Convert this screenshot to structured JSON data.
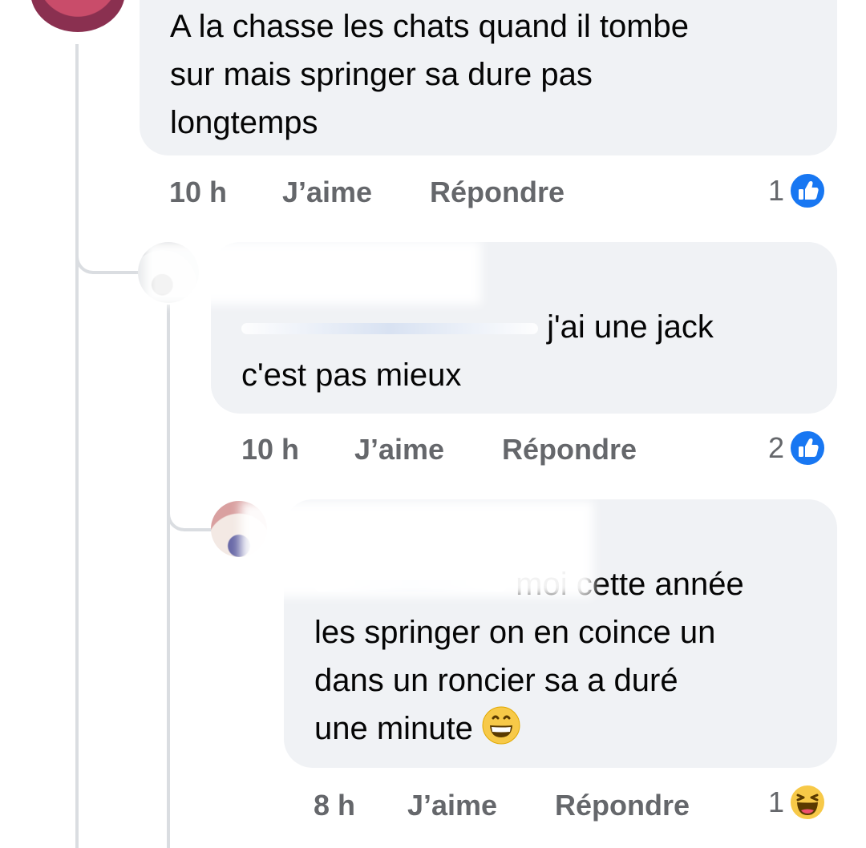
{
  "comments": [
    {
      "text": "A la chasse les chats quand il tombe\nsur mais springer sa dure pas\nlongtemps",
      "time": "10 h",
      "like_label": "J’aime",
      "reply_label": "Répondre",
      "reaction_count": "1",
      "reaction_icon": "like-icon"
    },
    {
      "text_line1": "j'ai une jack",
      "text_line2": "c'est pas mieux",
      "time": "10 h",
      "like_label": "J’aime",
      "reply_label": "Répondre",
      "reaction_count": "2",
      "reaction_icon": "like-icon"
    },
    {
      "text_line1": "moi cette année",
      "text_rest": "les springer on en coince un\ndans un roncier sa a duré\nune minute",
      "emoji": "grinning-face-icon",
      "time": "8 h",
      "like_label": "J’aime",
      "reply_label": "Répondre",
      "reaction_count": "1",
      "reaction_icon": "haha-icon"
    }
  ],
  "colors": {
    "bubble_bg": "#f0f2f5",
    "meta_text": "#65676b",
    "like_blue": "#1877f2",
    "thread_line": "#dadde1"
  }
}
